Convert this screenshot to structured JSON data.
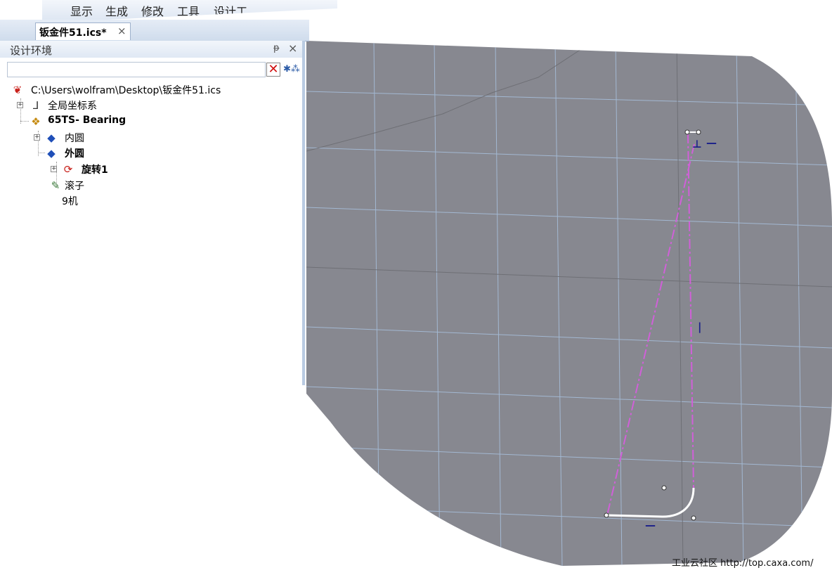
{
  "menu": {
    "items": [
      "显示",
      "生成",
      "修改",
      "工具",
      "设计工"
    ]
  },
  "document_tab": {
    "title": "钣金件51.ics*",
    "close_glyph": "×"
  },
  "panel": {
    "title": "设计环境",
    "pin_glyph": "ᵽ",
    "close_glyph": "×",
    "search_value": "",
    "search_placeholder": "",
    "tree": {
      "root_path": "C:\\Users\\wolfram\\Desktop\\钣金件51.ics",
      "coord_system": "全局坐标系",
      "assembly": "65TS- Bearing",
      "inner_ring": "内圆",
      "outer_ring": "外圆",
      "revolve": "旋转1",
      "roller": "滚子",
      "partial_item": "9机"
    }
  },
  "viewport": {
    "background": "#878890",
    "grid_color": "#9fb7d3",
    "sketch_color": "#ffffff",
    "construction_color": "#d060d8",
    "constraint_color": "#1a1f8a",
    "constraint_marks": [
      "⊥",
      "—",
      "|",
      "—"
    ]
  },
  "watermark": {
    "text": "工业云社区 http://top.caxa.com/"
  },
  "icons": {
    "clear": "clear-icon",
    "filter": "filter-icon",
    "root": "file-icon",
    "coord": "axes-icon",
    "assembly": "assembly-icon",
    "part": "part-icon",
    "revolve": "revolve-icon",
    "roller": "roller-icon"
  }
}
